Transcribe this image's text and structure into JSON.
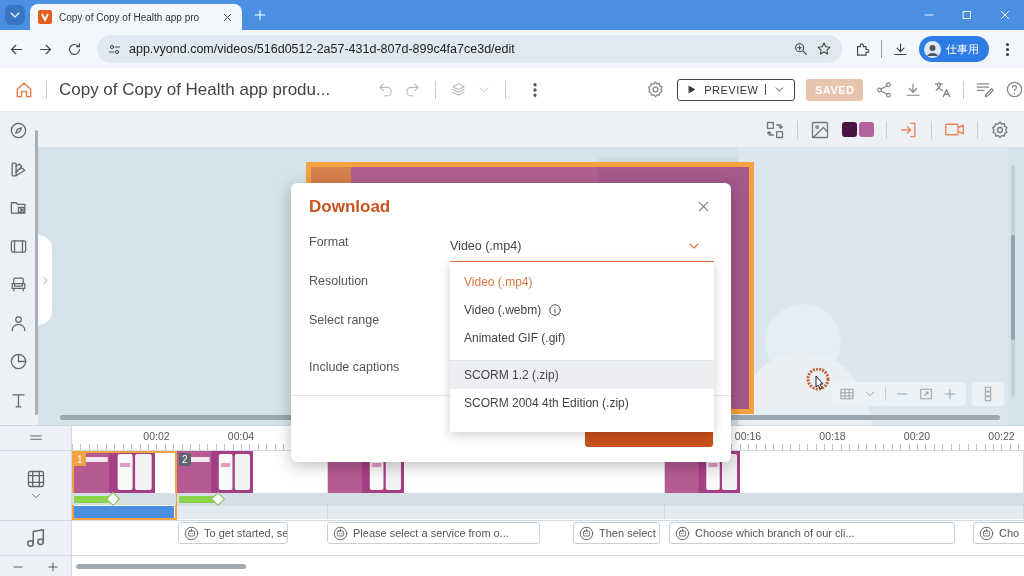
{
  "browser": {
    "tab_title": "Copy of Copy of Health app pro",
    "url": "app.vyond.com/videos/516d0512-2a57-431d-807d-899c4fa7ce3d/edit",
    "profile": "仕事用"
  },
  "header": {
    "title": "Copy of Copy of Health app produ...",
    "preview": "PREVIEW",
    "saved": "SAVED"
  },
  "toolbar": {
    "swatches": [
      {
        "color": "#4a1242"
      },
      {
        "color": "#b5609f"
      }
    ]
  },
  "dialog": {
    "title": "Download",
    "fields": [
      {
        "label": "Format"
      },
      {
        "label": "Resolution"
      },
      {
        "label": "Select range"
      },
      {
        "label": "Include captions"
      }
    ],
    "format_value": "Video (.mp4)",
    "options": [
      {
        "label": "Video (.mp4)",
        "selected": true,
        "hovered": false,
        "info": false
      },
      {
        "label": "Video (.webm)",
        "selected": false,
        "hovered": false,
        "info": true
      },
      {
        "label": "Animated GIF (.gif)",
        "selected": false,
        "hovered": false,
        "info": false
      },
      {
        "label": "SCORM 1.2 (.zip)",
        "selected": false,
        "hovered": true,
        "info": false
      },
      {
        "label": "SCORM 2004 4th Edition (.zip)",
        "selected": false,
        "hovered": false,
        "info": false
      }
    ]
  },
  "timeline": {
    "ticks_left": [
      "00:02",
      "00:04"
    ],
    "ticks_right": [
      "00:16",
      "00:18",
      "00:20",
      "00:22"
    ],
    "scenes": [
      {
        "number": "1",
        "selected": true,
        "effect": true
      },
      {
        "number": "2",
        "selected": false,
        "effect": true
      },
      {
        "selected": false,
        "effect": false
      },
      {
        "selected": false,
        "effect": false
      }
    ],
    "audio_clips": [
      {
        "text": "To get started, se"
      },
      {
        "text": "Please select a service from o..."
      },
      {
        "text": "Then select"
      },
      {
        "text": "Choose which branch of our cli..."
      },
      {
        "text": "Cho"
      }
    ]
  }
}
